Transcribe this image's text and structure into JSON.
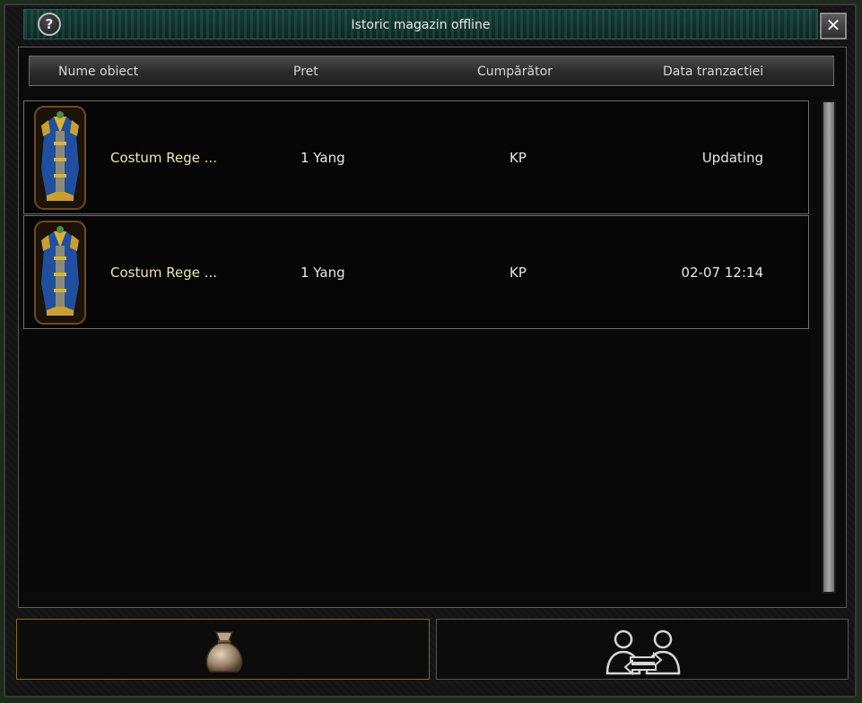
{
  "window": {
    "title": "Istoric magazin offline",
    "help_glyph": "?",
    "close_glyph": "✕"
  },
  "columns": [
    "Nume obiect",
    "Pret",
    "Cumpărător",
    "Data tranzactiei"
  ],
  "rows": [
    {
      "icon": "royal-costume-icon",
      "name": "Costum Rege ...",
      "price": "1 Yang",
      "buyer": "KP",
      "date": "Updating"
    },
    {
      "icon": "royal-costume-icon",
      "name": "Costum Rege ...",
      "price": "1 Yang",
      "buyer": "KP",
      "date": "02-07 12:14"
    }
  ],
  "scroll": {
    "position": 0.0
  },
  "buttons": [
    {
      "icon": "money-bag-icon",
      "selected": true
    },
    {
      "icon": "trade-users-icon",
      "selected": false
    }
  ],
  "colors": {
    "title_bg": "#143a33",
    "item_name": "#f0e6b0",
    "selected_button_border": "#8a6a1e"
  }
}
